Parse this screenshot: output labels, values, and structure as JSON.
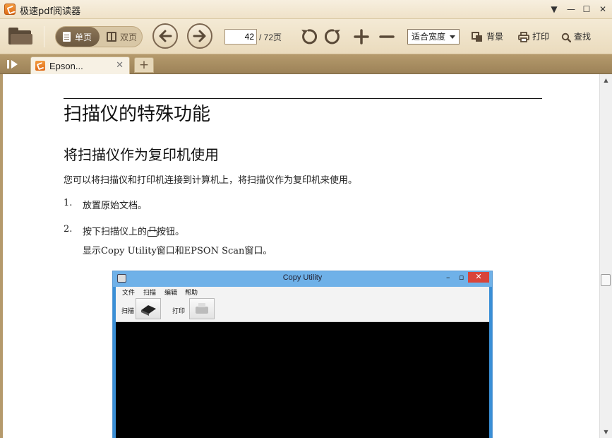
{
  "window": {
    "title": "极速pdf阅读器",
    "controls": {
      "menu": "▼",
      "minimize": "—",
      "maximize": "☐",
      "close": "✕"
    }
  },
  "toolbar": {
    "single_page_label": "单页",
    "double_page_label": "双页",
    "current_page": "42",
    "total_pages": "/ 72页",
    "zoom_mode": "适合宽度",
    "background_label": "背景",
    "print_label": "打印",
    "search_label": "查找"
  },
  "tabs": {
    "items": [
      {
        "label": "Epson...",
        "close": "✕"
      }
    ],
    "new_tab": "+"
  },
  "document": {
    "chapter_title": "扫描仪的特殊功能",
    "section_title": "将扫描仪作为复印机使用",
    "intro": "您可以将扫描仪和打印机连接到计算机上，将扫描仪作为复印机来使用。",
    "steps": [
      {
        "num": "1.",
        "text": "放置原始文档。"
      },
      {
        "num": "2.",
        "text_before": "按下扫描仪上的",
        "text_after": "按钮。"
      }
    ],
    "step2_note": "显示Copy Utility窗口和EPSON Scan窗口。",
    "figure": {
      "window_title": "Copy Utility",
      "menu": [
        "文件",
        "扫描",
        "编辑",
        "帮助"
      ],
      "scan_label": "扫描",
      "print_label": "打印"
    }
  },
  "scrollbar": {
    "up": "▲",
    "down": "▼"
  }
}
